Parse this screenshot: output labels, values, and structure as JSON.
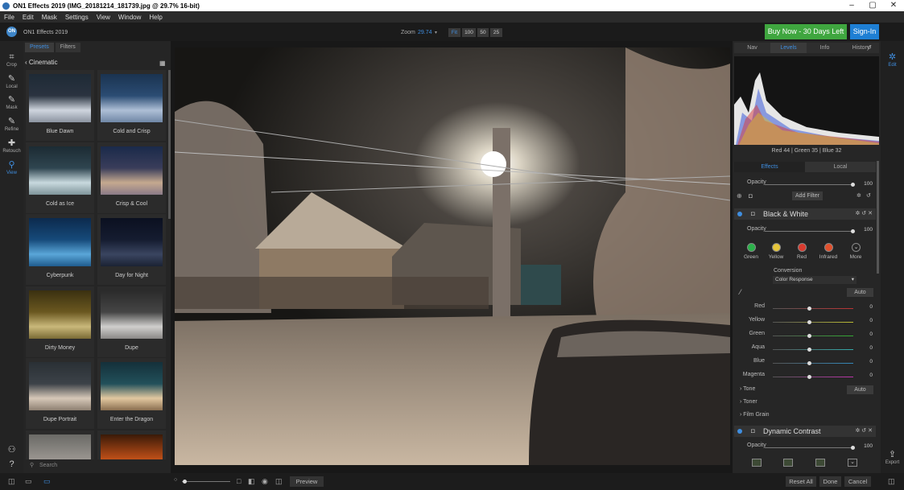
{
  "window": {
    "title": "ON1 Effects 2019 (IMG_20181214_181739.jpg @ 29.7% 16-bit)"
  },
  "menu": [
    "File",
    "Edit",
    "Mask",
    "Settings",
    "View",
    "Window",
    "Help"
  ],
  "topbar": {
    "logo": "ON",
    "app_name": "ON1 Effects 2019",
    "zoom_label": "Zoom",
    "zoom_value": "29.74",
    "zoom_buttons": [
      "Fit",
      "100",
      "50",
      "25"
    ],
    "buy_now": "Buy Now - 30 Days Left",
    "sign_in": "Sign-In"
  },
  "tools": [
    {
      "label": "Crop",
      "icon": "crop-icon",
      "glyph": "⌗"
    },
    {
      "label": "Local",
      "icon": "brush-icon",
      "glyph": "✎"
    },
    {
      "label": "Mask",
      "icon": "mask-brush-icon",
      "glyph": "✎"
    },
    {
      "label": "Refine",
      "icon": "refine-brush-icon",
      "glyph": "✎"
    },
    {
      "label": "Retouch",
      "icon": "retouch-icon",
      "glyph": "✚"
    },
    {
      "label": "View",
      "icon": "view-icon",
      "glyph": "⚲"
    }
  ],
  "browser": {
    "tabs": [
      "Presets",
      "Filters"
    ],
    "category": "Cinematic",
    "search_placeholder": "Search",
    "presets": [
      "Blue Dawn",
      "Cold and Crisp",
      "Cold as Ice",
      "Crisp & Cool",
      "Cyberpunk",
      "Day for Night",
      "Dirty Money",
      "Dupe",
      "Dupe Portrait",
      "Enter the Dragon"
    ]
  },
  "right": {
    "tabs": [
      "Nav",
      "Levels",
      "Info",
      "History"
    ],
    "selected_tab": "Levels",
    "rgb_readout": "Red  44  | Green  35  | Blue  32",
    "effect_tabs": [
      "Effects",
      "Local"
    ],
    "top_opacity_label": "Opacity",
    "top_opacity_value": "100",
    "add_filter": "Add Filter",
    "bw": {
      "title": "Black & White",
      "opacity_label": "Opacity",
      "opacity_value": "100",
      "swatches": [
        {
          "label": "Green",
          "color": "#2bb14a"
        },
        {
          "label": "Yellow",
          "color": "#e5c53a"
        },
        {
          "label": "Red",
          "color": "#d93b2f"
        },
        {
          "label": "Infrared",
          "color": "#e0502d"
        },
        {
          "label": "More",
          "color": "#262626"
        }
      ],
      "conversion_label": "Conversion",
      "conversion_value": "Color Response",
      "auto": "Auto",
      "channels": [
        {
          "label": "Red",
          "value": "0",
          "color": "#b33"
        },
        {
          "label": "Yellow",
          "value": "0",
          "color": "#bb3"
        },
        {
          "label": "Green",
          "value": "0",
          "color": "#3a3"
        },
        {
          "label": "Aqua",
          "value": "0",
          "color": "#3aa"
        },
        {
          "label": "Blue",
          "value": "0",
          "color": "#38b"
        },
        {
          "label": "Magenta",
          "value": "0",
          "color": "#b3a"
        }
      ],
      "sections": [
        "Tone",
        "Toner",
        "Film Grain"
      ],
      "tone_auto": "Auto"
    },
    "dc": {
      "title": "Dynamic Contrast",
      "opacity_label": "Opacity",
      "opacity_value": "100"
    }
  },
  "farright": {
    "edit": "Edit",
    "export": "Export"
  },
  "bottom": {
    "preview": "Preview",
    "reset_all": "Reset All",
    "done": "Done",
    "cancel": "Cancel"
  }
}
